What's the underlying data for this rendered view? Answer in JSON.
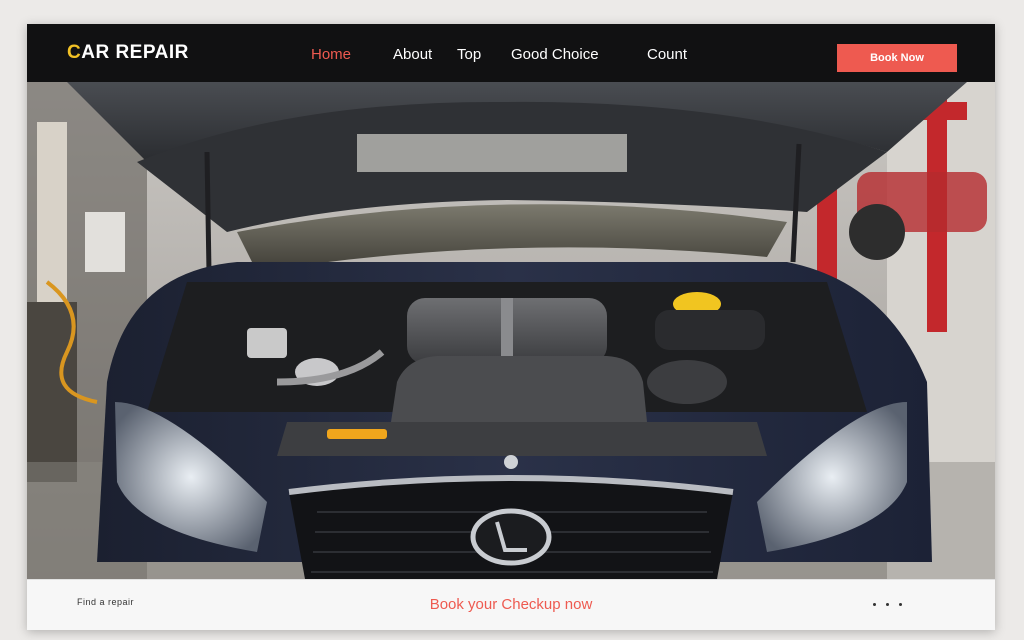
{
  "header": {
    "logo_accent": "C",
    "logo_rest": "AR REPAIR",
    "nav": [
      {
        "label": "Home",
        "active": true
      },
      {
        "label": "About"
      },
      {
        "label": "Top"
      },
      {
        "label": "Good Choice"
      },
      {
        "label": "Count"
      }
    ],
    "cta_label": "Book Now"
  },
  "hero": {
    "image": "car-engine-hood-open-photo"
  },
  "footer": {
    "left_text": "Find a repair",
    "center_text": "Book your Checkup now",
    "dots_count": 3
  },
  "colors": {
    "accent": "#ee5a50",
    "logo_accent": "#f2c125",
    "header_bg": "#111112"
  }
}
